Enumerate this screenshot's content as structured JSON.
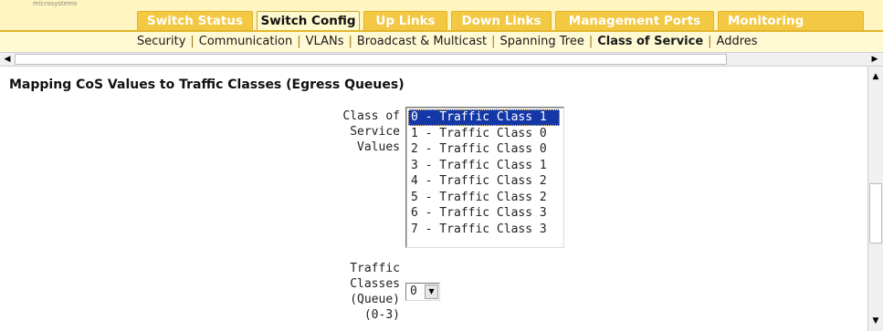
{
  "logo": {
    "text": "microsystems"
  },
  "tabs": [
    {
      "label": "Switch Status",
      "active": false
    },
    {
      "label": "Switch Config",
      "active": true
    },
    {
      "label": "Up Links",
      "active": false
    },
    {
      "label": "Down Links",
      "active": false
    },
    {
      "label": "Management Ports",
      "active": false
    },
    {
      "label": "Monitoring",
      "active": false
    }
  ],
  "subnav": [
    {
      "label": "Security",
      "current": false
    },
    {
      "label": "Communication",
      "current": false
    },
    {
      "label": "VLANs",
      "current": false
    },
    {
      "label": "Broadcast & Multicast",
      "current": false
    },
    {
      "label": "Spanning Tree",
      "current": false
    },
    {
      "label": "Class of Service",
      "current": true
    },
    {
      "label": "Addres",
      "current": false
    }
  ],
  "section": {
    "title": "Mapping CoS Values to Traffic Classes (Egress Queues)"
  },
  "cos_field": {
    "label_lines": [
      "Class of",
      "Service",
      "Values"
    ],
    "options": [
      {
        "text": "0 - Traffic Class 1",
        "selected": true
      },
      {
        "text": "1 - Traffic Class 0",
        "selected": false
      },
      {
        "text": "2 - Traffic Class 0",
        "selected": false
      },
      {
        "text": "3 - Traffic Class 1",
        "selected": false
      },
      {
        "text": "4 - Traffic Class 2",
        "selected": false
      },
      {
        "text": "5 - Traffic Class 2",
        "selected": false
      },
      {
        "text": "6 - Traffic Class 3",
        "selected": false
      },
      {
        "text": "7 - Traffic Class 3",
        "selected": false
      }
    ]
  },
  "traffic_class_field": {
    "label_lines": [
      "Traffic",
      "Classes",
      "(Queue)",
      "(0-3)"
    ],
    "selected_value": "0"
  },
  "icons": {
    "scroll_left": "arrow-left-icon",
    "scroll_right": "arrow-right-icon",
    "scroll_up": "arrow-up-icon",
    "scroll_down": "arrow-down-icon",
    "dropdown": "chevron-down-icon"
  },
  "colors": {
    "tab_bg": "#f3c842",
    "tab_active_bg": "#fff9d0",
    "subnav_bg": "#fff9d4",
    "selection_bg": "#1437a8"
  }
}
